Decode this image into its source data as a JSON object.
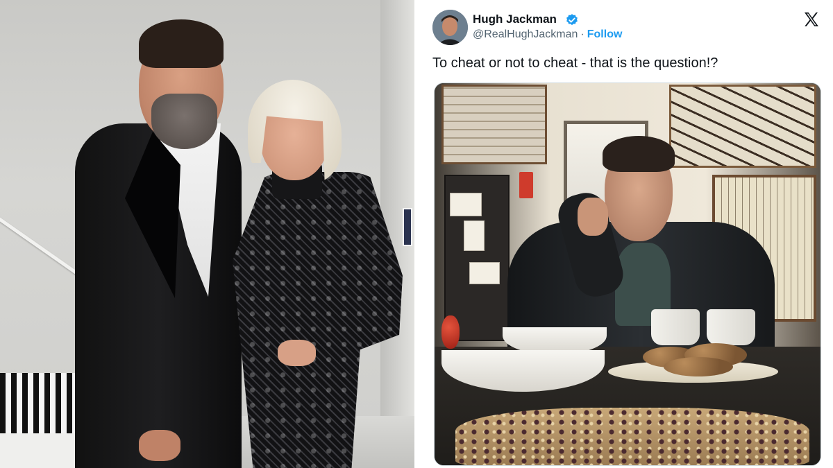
{
  "tweet": {
    "display_name": "Hugh Jackman",
    "handle": "@RealHughJackman",
    "separator": "·",
    "follow_label": "Follow",
    "text": "To cheat or not to cheat - that is the question!?",
    "verified_color": "#1d9bf0",
    "follow_color": "#1d9bf0",
    "icons": {
      "verified": "verified-badge-icon",
      "platform": "x-logo-icon"
    }
  }
}
